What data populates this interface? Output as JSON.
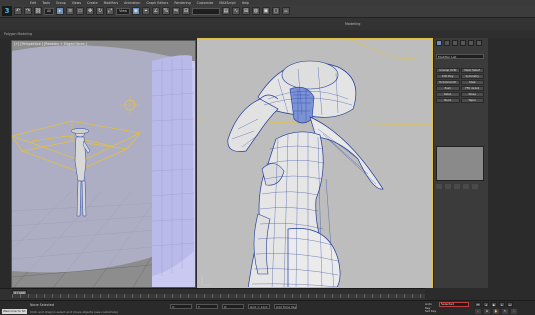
{
  "menubar": {
    "items": [
      "Edit",
      "Tools",
      "Group",
      "Views",
      "Create",
      "Modifiers",
      "Animation",
      "Graph Editors",
      "Rendering",
      "Customize",
      "MAXScript",
      "Help"
    ]
  },
  "toolbar": {
    "selection_filter": "All",
    "view_dropdown": "View",
    "named_selection": ""
  },
  "ribbon": {
    "tab_label": "Modeling",
    "sub_label": "Polygon Modeling"
  },
  "left_viewport": {
    "label": "[+] [Perspective ] [Realistic + Edged Faces ]"
  },
  "command_panel": {
    "modifier_list": "Modifier List",
    "buttons": [
      "Unwrap UVW",
      "Mesh Select",
      "Edit Poly",
      "Symmetry",
      "TurboSmooth",
      "Shell",
      "Push",
      "FFD 4x4x4",
      "Relax",
      "Noise",
      "Bend",
      "Taper"
    ]
  },
  "timeline": {
    "frame": "0 / 100"
  },
  "statusbar": {
    "welcome": "Welcome to 3d",
    "selection": "None Selected",
    "hint": "Click and drag to select and move objects (see customize)",
    "x": "X:",
    "y": "Y:",
    "z": "Z:",
    "grid": "Grid = 10.0",
    "add_time_tag": "Add Time Tag"
  },
  "anim": {
    "auto_key": "Auto Key",
    "set_key": "Set Key",
    "selected": "Selected",
    "key_filters": "Key Filters..."
  },
  "colors": {
    "accent": "#6a8fb8",
    "mesh_wire": "#1f3a99",
    "viewport_border": "#e0c14a",
    "cylinder": "#c9c9f2"
  }
}
